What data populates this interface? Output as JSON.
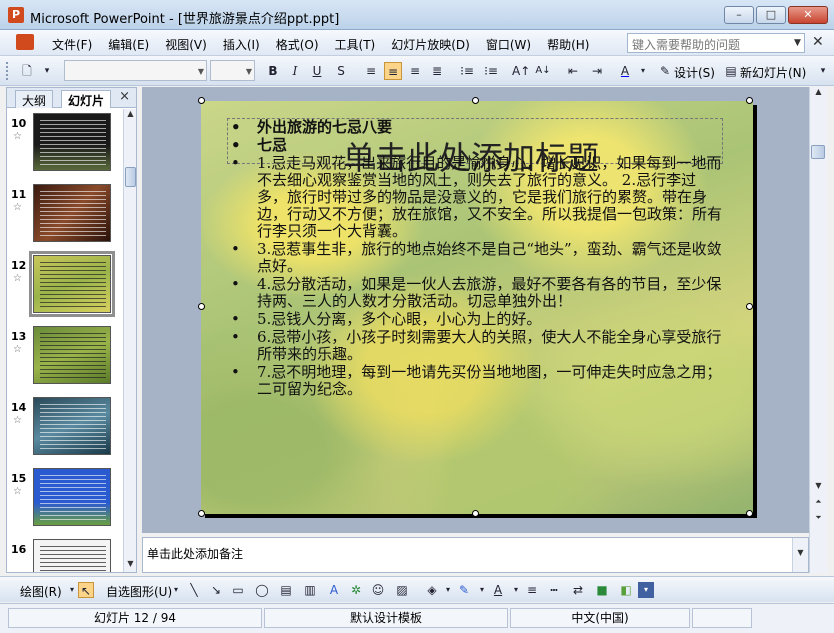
{
  "window": {
    "title": "Microsoft PowerPoint - [世界旅游景点介绍ppt.ppt]",
    "min": "–",
    "max": "□",
    "close": "✕"
  },
  "menu": {
    "items": [
      "文件(F)",
      "编辑(E)",
      "视图(V)",
      "插入(I)",
      "格式(O)",
      "工具(T)",
      "幻灯片放映(D)",
      "窗口(W)",
      "帮助(H)"
    ],
    "help_placeholder": "键入需要帮助的问题"
  },
  "toolbar": {
    "design_label": "设计(S)",
    "new_slide_label": "新幻灯片(N)",
    "font_name": "",
    "font_size": ""
  },
  "left_pane": {
    "tabs": [
      "大纲",
      "幻灯片"
    ],
    "close": "×",
    "thumbnails": [
      {
        "num": "10"
      },
      {
        "num": "11"
      },
      {
        "num": "12",
        "selected": true
      },
      {
        "num": "13"
      },
      {
        "num": "14"
      },
      {
        "num": "15"
      },
      {
        "num": "16"
      }
    ]
  },
  "slide": {
    "title_placeholder": "单击此处添加标题",
    "bullets": [
      {
        "text": "外出旅游的七忌八要",
        "bold": true
      },
      {
        "text": "七忌",
        "bold": true
      },
      {
        "text": "       1.忌走马观花，出来旅行目的是愉悦身心，增长见识，如果每到一地而不去细心观察鉴赏当地的风土，则失去了旅行的意义。   2.忌行李过多，旅行时带过多的物品是没意义的，它是我们旅行的累赘。带在身边，行动又不方便；放在旅馆，又不安全。所以我提倡一包政策：所有行李只须一个大背囊。"
      },
      {
        "text": "       3.忌惹事生非，旅行的地点始终不是自己“地头”，蛮劲、霸气还是收敛点好。"
      },
      {
        "text": "       4.忌分散活动，如果是一伙人去旅游，最好不要各有各的节目，至少保持两、三人的人数才分散活动。切忌单独外出！"
      },
      {
        "text": "       5.忌钱人分离，多个心眼，小心为上的好。"
      },
      {
        "text": "       6.忌带小孩，小孩子时刻需要大人的关照，使大人不能全身心享受旅行所带来的乐趣。"
      },
      {
        "text": "       7.忌不明地理，每到一地请先买份当地地图，一可伸走失时应急之用；二可留为纪念。"
      }
    ]
  },
  "notes": {
    "placeholder": "单击此处添加备注"
  },
  "drawbar": {
    "draw_label": "绘图(R)",
    "autoshape_label": "自选图形(U)"
  },
  "status": {
    "slide_info": "幻灯片 12 / 94",
    "template": "默认设计模板",
    "language": "中文(中国)"
  }
}
